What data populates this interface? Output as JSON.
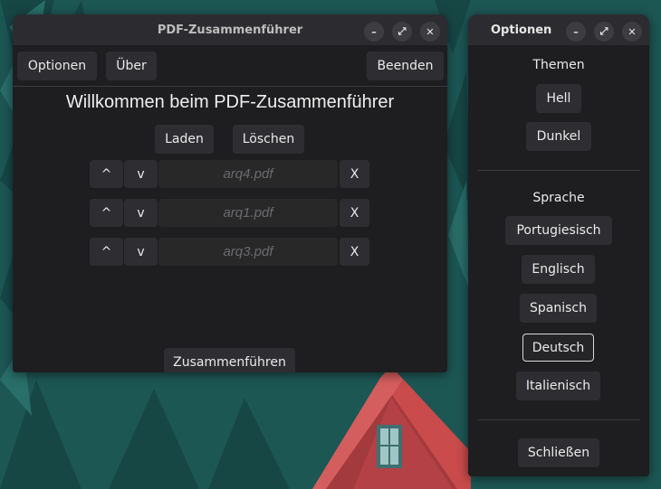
{
  "main_window": {
    "title": "PDF-Zusammenführer",
    "menu": {
      "options": "Optionen",
      "about": "Über",
      "quit": "Beenden"
    },
    "heading": "Willkommen beim PDF-Zusammenführer",
    "load": "Laden",
    "clear": "Löschen",
    "files": [
      {
        "up": "^",
        "down": "v",
        "name": "arq4.pdf",
        "remove": "X"
      },
      {
        "up": "^",
        "down": "v",
        "name": "arq1.pdf",
        "remove": "X"
      },
      {
        "up": "^",
        "down": "v",
        "name": "arq3.pdf",
        "remove": "X"
      }
    ],
    "merge": "Zusammenführen"
  },
  "options_window": {
    "title": "Optionen",
    "themes_label": "Themen",
    "themes": [
      "Hell",
      "Dunkel"
    ],
    "language_label": "Sprache",
    "languages": [
      "Portugiesisch",
      "Englisch",
      "Spanisch",
      "Deutsch",
      "Italienisch"
    ],
    "selected_language": "Deutsch",
    "close": "Schließen"
  },
  "wm_icons": {
    "minimize": "minimize-icon",
    "maximize": "maximize-icon",
    "close": "close-icon"
  },
  "colors": {
    "window_bg": "#1e1e20",
    "titlebar": "#2c2c30",
    "button": "#2e2e32",
    "wallpaper": "#1f5a57",
    "roof": "#c94b4b"
  }
}
